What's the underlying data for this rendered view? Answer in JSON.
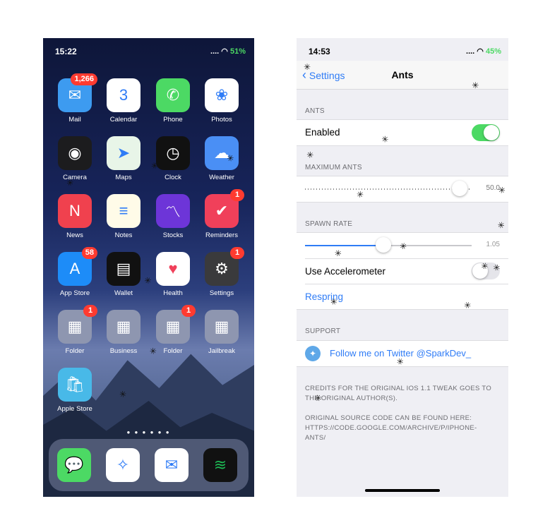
{
  "home": {
    "status": {
      "time": "15:22",
      "signal": ".... ",
      "battery": "51%"
    },
    "apps": [
      {
        "label": "Mail",
        "badge": "1,266",
        "icon": "mail-icon",
        "glyph": "✉",
        "color": "#3d9bf0"
      },
      {
        "label": "Calendar",
        "badge": "",
        "icon": "calendar-icon",
        "glyph": "3",
        "color": "#ffffff"
      },
      {
        "label": "Phone",
        "badge": "",
        "icon": "phone-icon",
        "glyph": "✆",
        "color": "#4cd964"
      },
      {
        "label": "Photos",
        "badge": "",
        "icon": "photos-icon",
        "glyph": "❀",
        "color": "#ffffff"
      },
      {
        "label": "Camera",
        "badge": "",
        "icon": "camera-icon",
        "glyph": "◉",
        "color": "#1c1c1e"
      },
      {
        "label": "Maps",
        "badge": "",
        "icon": "maps-icon",
        "glyph": "➤",
        "color": "#e8f5e8"
      },
      {
        "label": "Clock",
        "badge": "",
        "icon": "clock-icon",
        "glyph": "◷",
        "color": "#111111"
      },
      {
        "label": "Weather",
        "badge": "",
        "icon": "weather-icon",
        "glyph": "☁",
        "color": "#4a8ff5"
      },
      {
        "label": "News",
        "badge": "",
        "icon": "news-icon",
        "glyph": "N",
        "color": "#f0414e"
      },
      {
        "label": "Notes",
        "badge": "",
        "icon": "notes-icon",
        "glyph": "≡",
        "color": "#fffbe8"
      },
      {
        "label": "Stocks",
        "badge": "",
        "icon": "stocks-icon",
        "glyph": "〽",
        "color": "#6d35d8"
      },
      {
        "label": "Reminders",
        "badge": "1",
        "icon": "reminders-icon",
        "glyph": "✔",
        "color": "#f0405a"
      },
      {
        "label": "App Store",
        "badge": "58",
        "icon": "app-store-icon",
        "glyph": "A",
        "color": "#1d8cf8"
      },
      {
        "label": "Wallet",
        "badge": "",
        "icon": "wallet-icon",
        "glyph": "▤",
        "color": "#111111"
      },
      {
        "label": "Health",
        "badge": "",
        "icon": "health-icon",
        "glyph": "♥",
        "color": "#ffffff"
      },
      {
        "label": "Settings",
        "badge": "1",
        "icon": "settings-icon",
        "glyph": "⚙",
        "color": "#3a3a3c"
      },
      {
        "label": "Folder",
        "badge": "1",
        "icon": "folder-icon",
        "glyph": "▦",
        "color": "#8e96b0"
      },
      {
        "label": "Business",
        "badge": "",
        "icon": "business-folder-icon",
        "glyph": "▦",
        "color": "#8e96b0"
      },
      {
        "label": "Folder",
        "badge": "1",
        "icon": "folder-icon",
        "glyph": "▦",
        "color": "#8e96b0"
      },
      {
        "label": "Jailbreak",
        "badge": "",
        "icon": "jailbreak-folder-icon",
        "glyph": "▦",
        "color": "#8e96b0"
      },
      {
        "label": "Apple Store",
        "badge": "",
        "icon": "apple-store-icon",
        "glyph": "🛍",
        "color": "#48b9e8"
      }
    ],
    "dock": [
      {
        "icon": "messages-icon",
        "glyph": "💬",
        "color": "#4cd964"
      },
      {
        "icon": "safari-icon",
        "glyph": "✧",
        "color": "#ffffff"
      },
      {
        "icon": "messenger-icon",
        "glyph": "✉",
        "color": "#ffffff"
      },
      {
        "icon": "spotify-icon",
        "glyph": "≋",
        "color": "#111111"
      }
    ],
    "page_dots": "● ● ● ● ● ●"
  },
  "settings": {
    "status": {
      "time": "14:53",
      "signal": ".... ",
      "battery": "45%"
    },
    "back_label": "Settings",
    "title": "Ants",
    "ants_header": "ANTS",
    "enabled_label": "Enabled",
    "enabled": true,
    "max_header": "MAXIMUM ANTS",
    "max_value": "50.0",
    "max_fraction": 0.93,
    "spawn_header": "SPAWN RATE",
    "spawn_value": "1.05",
    "spawn_fraction": 0.47,
    "accelerometer_label": "Use Accelerometer",
    "accelerometer": false,
    "respring_label": "Respring",
    "support_header": "SUPPORT",
    "twitter_label": "Follow me on Twitter @SparkDev_",
    "credits": "CREDITS FOR THE ORIGINAL IOS 1.1 TWEAK GOES TO THE ORIGINAL AUTHOR(S).",
    "source": "ORIGINAL SOURCE CODE CAN BE FOUND HERE: HTTPS://CODE.GOOGLE.COM/ARCHIVE/P/IPHONE-ANTS/"
  }
}
